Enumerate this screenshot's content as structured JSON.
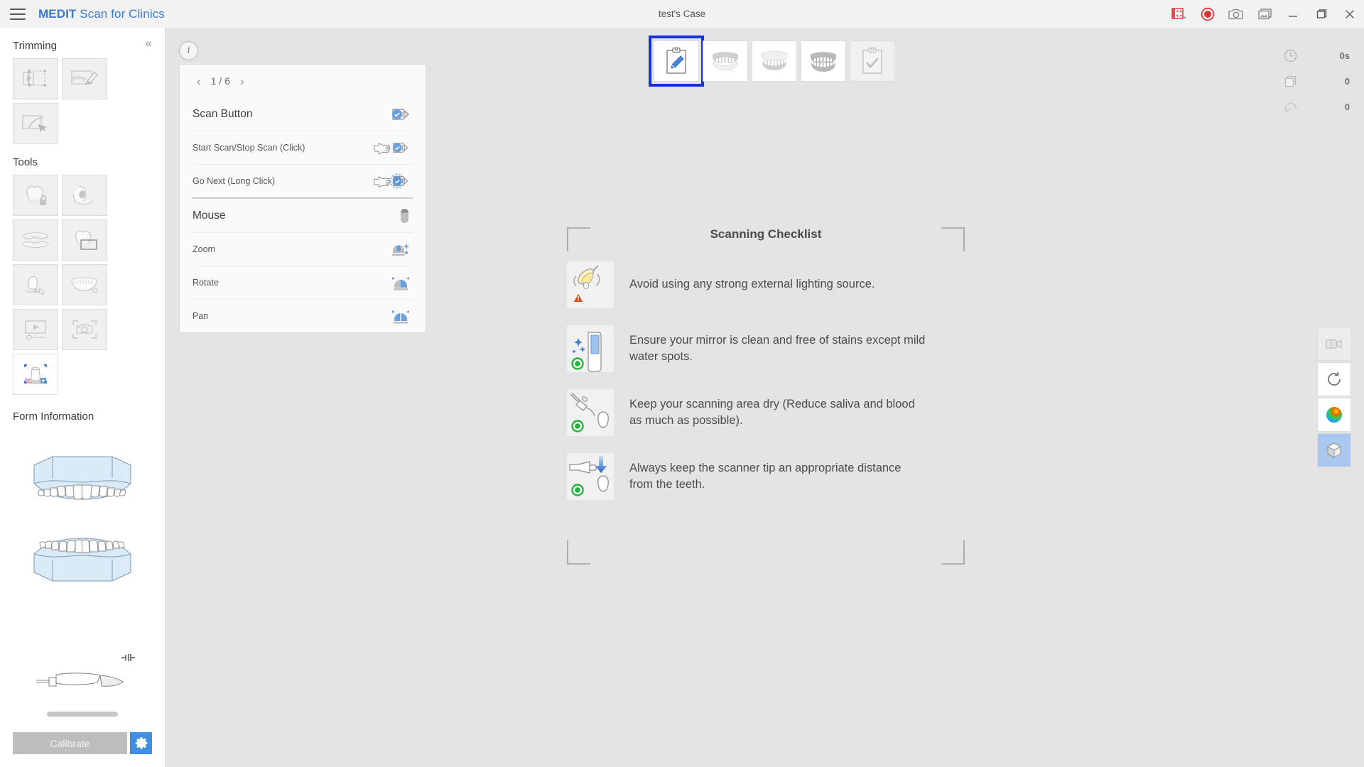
{
  "titlebar": {
    "app_name_bold": "MEDIT",
    "app_name_rest": " Scan for Clinics",
    "case_title": "test's Case",
    "menu_icon": "hamburger-icon",
    "controls": [
      {
        "name": "screenshot-region-icon",
        "label": ""
      },
      {
        "name": "record-icon",
        "label": ""
      },
      {
        "name": "camera-icon",
        "label": ""
      },
      {
        "name": "gallery-icon",
        "label": ""
      },
      {
        "name": "minimize-icon",
        "label": ""
      },
      {
        "name": "maximize-icon",
        "label": ""
      },
      {
        "name": "close-icon",
        "label": ""
      }
    ],
    "accent_red": "#e03131",
    "accent_blue": "#3a79d0"
  },
  "sidebar": {
    "trimming_title": "Trimming",
    "collapse_label": "«",
    "tools_title": "Tools",
    "form_info_title": "Form Information",
    "trimming_tools": [
      {
        "name": "trim-select-box-icon"
      },
      {
        "name": "trim-brush-icon"
      },
      {
        "name": "trim-lasso-icon"
      }
    ],
    "tools": [
      {
        "name": "tool-lock-tooth-icon"
      },
      {
        "name": "tool-margin-line-icon"
      },
      {
        "name": "tool-full-arch-icon"
      },
      {
        "name": "tool-crop-box-icon"
      },
      {
        "name": "tool-measure-icon"
      },
      {
        "name": "tool-arch-settings-icon"
      },
      {
        "name": "tool-video-playback-icon"
      },
      {
        "name": "tool-capture-frame-icon"
      },
      {
        "name": "tool-align-color-icon"
      }
    ],
    "calibrate_label": "Calibrate",
    "calibrate_gear": "gear-icon",
    "scanner_icon": "scanner-wand-icon",
    "plug_icon": "connector-icon"
  },
  "info_panel": {
    "info_icon": "info-icon",
    "prev_label": "‹",
    "next_label": "›",
    "page_label": "1 / 6",
    "sections": [
      {
        "header": "Scan Button",
        "header_icon": "scan-button-icon",
        "rows": [
          {
            "label": "Start Scan/Stop Scan (Click)",
            "icon": "hand-click-scan-icon"
          },
          {
            "label": "Go Next (Long Click)",
            "icon": "hand-long-click-scan-icon"
          }
        ]
      },
      {
        "header": "Mouse",
        "header_icon": "mouse-icon",
        "rows": [
          {
            "label": "Zoom",
            "icon": "mouse-zoom-icon"
          },
          {
            "label": "Rotate",
            "icon": "mouse-rotate-icon"
          },
          {
            "label": "Pan",
            "icon": "mouse-pan-icon"
          }
        ]
      }
    ]
  },
  "tabs": [
    {
      "name": "tab-form",
      "icon": "clipboard-pencil-icon",
      "selected": true
    },
    {
      "name": "tab-upper-jaw",
      "icon": "upper-arch-icon",
      "selected": false
    },
    {
      "name": "tab-lower-jaw",
      "icon": "lower-arch-icon",
      "selected": false
    },
    {
      "name": "tab-occlusion",
      "icon": "occlusion-arch-icon",
      "selected": false
    },
    {
      "name": "tab-confirm",
      "icon": "clipboard-check-icon",
      "selected": false
    }
  ],
  "status": [
    {
      "name": "scan-time",
      "icon": "clock-icon",
      "value": "0s"
    },
    {
      "name": "scan-data-count",
      "icon": "layers-icon",
      "value": "0"
    },
    {
      "name": "scan-speed",
      "icon": "gauge-icon",
      "value": "0"
    }
  ],
  "right_tools": [
    {
      "name": "video-record-tool",
      "icon": "video-camera-icon",
      "state": "disabled"
    },
    {
      "name": "reset-view-tool",
      "icon": "refresh-icon",
      "state": "normal"
    },
    {
      "name": "color-map-tool",
      "icon": "color-sphere-icon",
      "state": "normal"
    },
    {
      "name": "model-view-tool",
      "icon": "cube-icon",
      "state": "active"
    }
  ],
  "checklist": {
    "title": "Scanning Checklist",
    "items": [
      {
        "icon": "dental-lamp-icon",
        "badge": "warning-badge",
        "text": "Avoid using any strong external lighting source."
      },
      {
        "icon": "clean-mirror-icon",
        "badge": "ok-badge",
        "text": "Ensure your mirror is clean and free of stains except mild water spots."
      },
      {
        "icon": "air-syringe-tooth-icon",
        "badge": "ok-badge",
        "text": "Keep your scanning area dry (Reduce saliva and blood as much as possible)."
      },
      {
        "icon": "scanner-distance-icon",
        "badge": "ok-badge",
        "text": "Always keep the scanner tip an appropriate distance from the teeth."
      }
    ],
    "warning_color": "#d9480f",
    "ok_color": "#20b33a"
  }
}
